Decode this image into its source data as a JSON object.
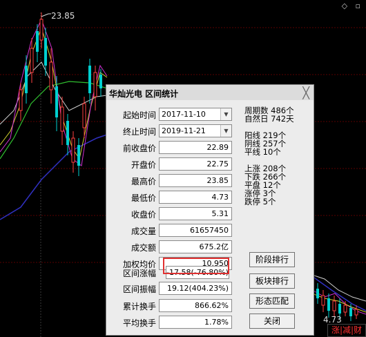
{
  "chart": {
    "high_label": "23.85",
    "low_label": "4.73",
    "corner_icons": "◇ ▫",
    "corner_button": "涨|减|财"
  },
  "dialog": {
    "title": "华灿光电 区间统计",
    "close_glyph": "╳",
    "start_label": "起始时间",
    "start_value": "2017-11-10",
    "end_label": "终止时间",
    "end_value": "2019-11-21",
    "rows": [
      {
        "label": "前收盘价",
        "value": "22.89"
      },
      {
        "label": "开盘价",
        "value": "22.75"
      },
      {
        "label": "最高价",
        "value": "23.85"
      },
      {
        "label": "最低价",
        "value": "4.73"
      },
      {
        "label": "收盘价",
        "value": "5.31"
      },
      {
        "label": "成交量",
        "value": "61657450"
      },
      {
        "label": "成交额",
        "value": "675.2亿"
      },
      {
        "label": "加权均价",
        "value": "10.950"
      },
      {
        "label": "区间涨幅",
        "value": "-17.58(-76.80%)"
      },
      {
        "label": "区间振幅",
        "value": "19.12(404.23%)"
      },
      {
        "label": "累计换手",
        "value": "866.62%"
      },
      {
        "label": "平均换手",
        "value": "1.78%"
      }
    ],
    "stats": {
      "weeks": "周期数  486个",
      "days": "自然日  742天",
      "yang": "阳线  219个",
      "yin": "阴线  257个",
      "flat": "平线  10个",
      "up": "上涨  208个",
      "down": "下跌  266个",
      "even": "平盘  12个",
      "limit_up": "涨停  3个",
      "limit_down": "跌停  5个"
    },
    "buttons": {
      "stage_rank": "阶段排行",
      "sector_rank": "板块排行",
      "pattern_match": "形态匹配",
      "close": "关闭"
    }
  }
}
